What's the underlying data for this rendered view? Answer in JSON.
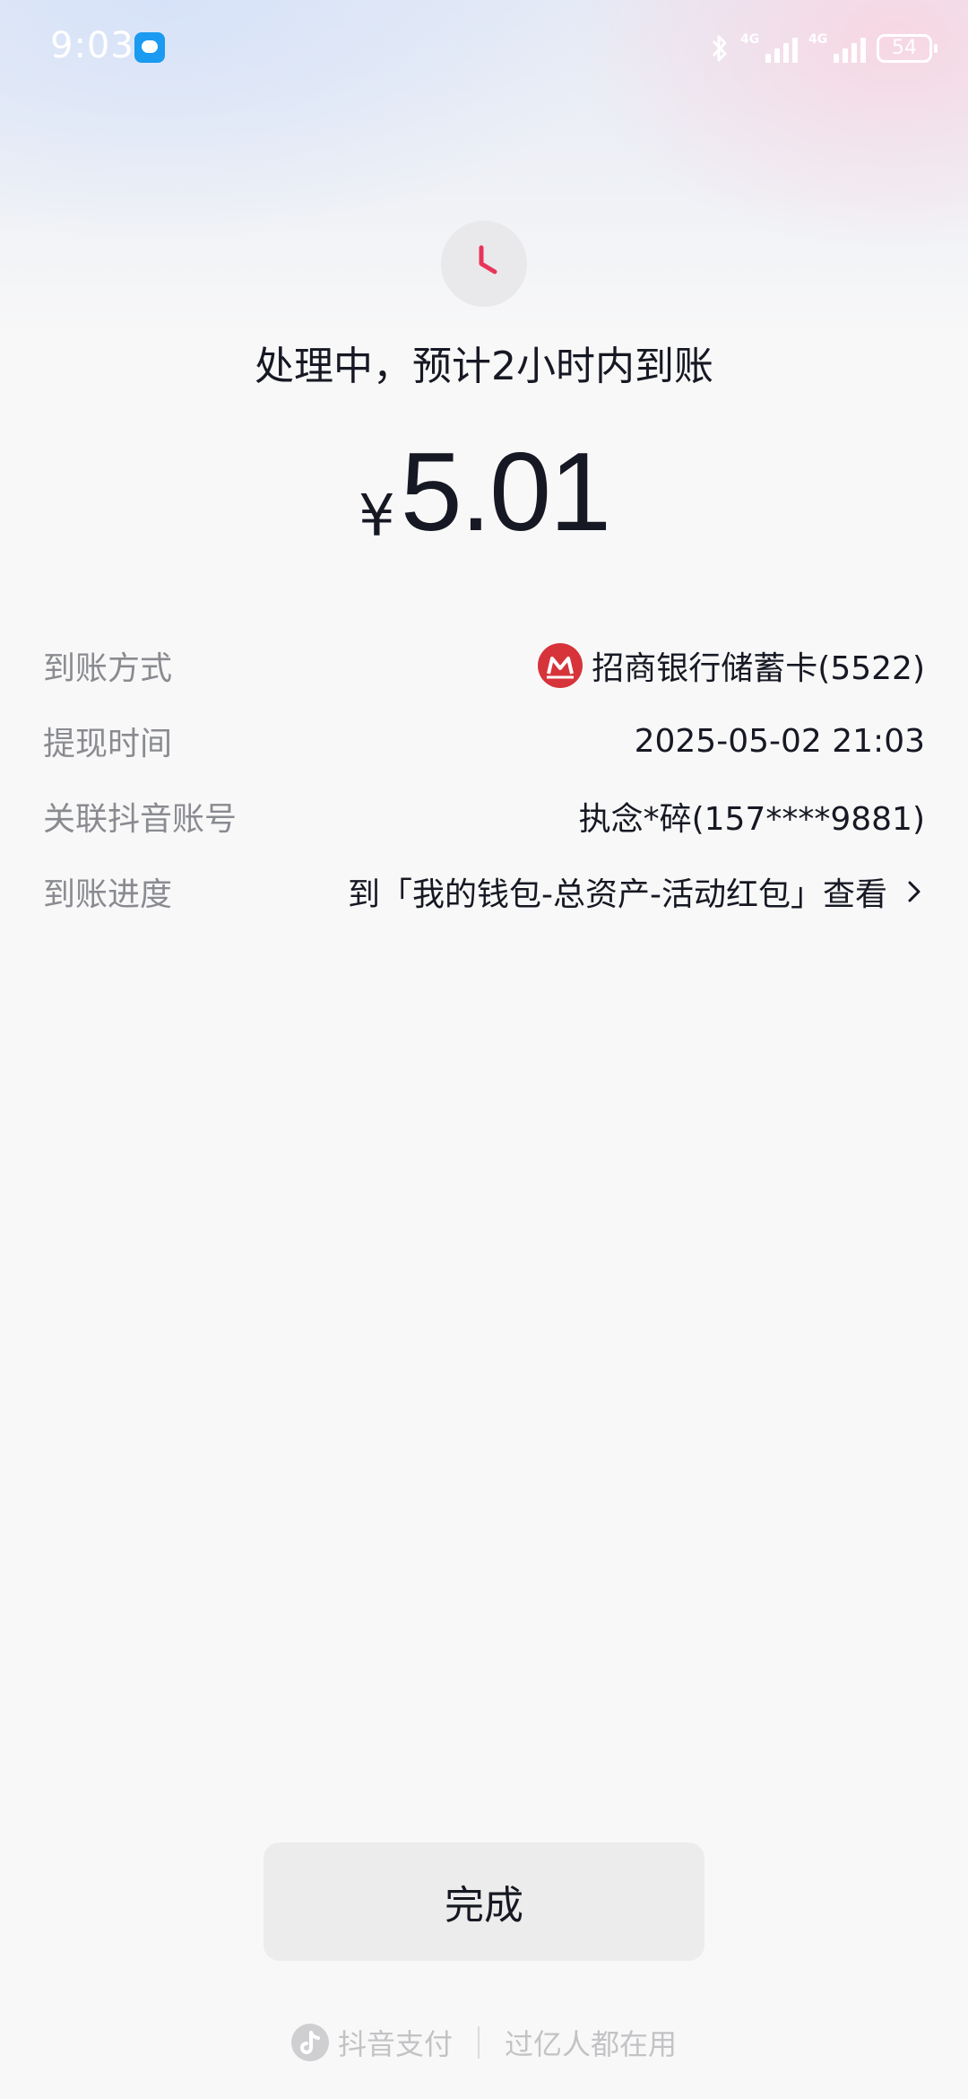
{
  "status_bar": {
    "time": "9:03",
    "network_1": "4G",
    "network_2": "4G",
    "battery": "54"
  },
  "state": {
    "title": "处理中，预计2小时内到账"
  },
  "amount": {
    "currency": "¥",
    "value": "5.01"
  },
  "details": [
    {
      "label": "到账方式",
      "value": "招商银行储蓄卡(5522)"
    },
    {
      "label": "提现时间",
      "value": "2025-05-02 21:03"
    },
    {
      "label": "关联抖音账号",
      "value": "执念*碎(157****9881)"
    },
    {
      "label": "到账进度",
      "value": "到「我的钱包-总资产-活动红包」查看"
    }
  ],
  "done_button": "完成",
  "footer": {
    "brand": "抖音支付",
    "slogan": "过亿人都在用"
  },
  "colors": {
    "accent": "#e8345b",
    "bank_logo": "#d7333a",
    "label_gray": "#8a8b91",
    "text": "#161823"
  },
  "icons": [
    "message-icon",
    "bluetooth-icon",
    "signal-icon",
    "battery-icon",
    "clock-icon",
    "bank-logo-icon",
    "chevron-right-icon",
    "douyin-logo-icon"
  ]
}
